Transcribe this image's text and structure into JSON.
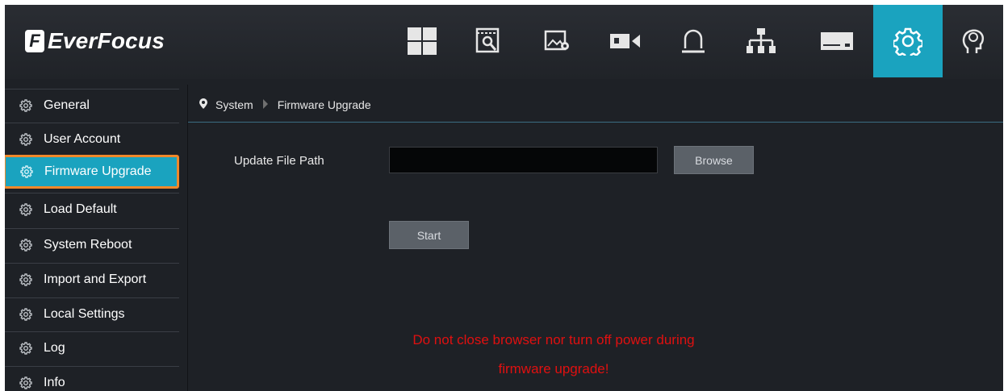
{
  "header": {
    "logo_text": "EverFocus",
    "logo_mark": "F",
    "nav_items": [
      {
        "icon": "live-view-grid-icon",
        "active": false
      },
      {
        "icon": "playback-search-icon",
        "active": false
      },
      {
        "icon": "image-settings-icon",
        "active": false
      },
      {
        "icon": "camera-icon",
        "active": false
      },
      {
        "icon": "alarm-bell-icon",
        "active": false
      },
      {
        "icon": "network-icon",
        "active": false
      },
      {
        "icon": "storage-hdd-icon",
        "active": false
      },
      {
        "icon": "system-gear-icon",
        "active": true
      },
      {
        "icon": "user-head-icon",
        "active": false
      }
    ],
    "accent_color": "#1aa3bf"
  },
  "sidebar": {
    "items": [
      {
        "label": "General"
      },
      {
        "label": "User Account"
      },
      {
        "label": "Firmware Upgrade",
        "active": true
      },
      {
        "label": "Load Default"
      },
      {
        "label": "System Reboot"
      },
      {
        "label": "Import and Export"
      },
      {
        "label": "Local Settings"
      },
      {
        "label": "Log"
      },
      {
        "label": "Info"
      }
    ],
    "highlight_border_color": "#f0882a"
  },
  "breadcrumb": {
    "root": "System",
    "current": "Firmware Upgrade"
  },
  "form": {
    "update_file_label": "Update File Path",
    "update_file_value": "",
    "browse_label": "Browse",
    "start_label": "Start"
  },
  "warning": {
    "line1": "Do not close browser nor turn off power during",
    "line2": "firmware upgrade!",
    "color": "#e01010"
  }
}
